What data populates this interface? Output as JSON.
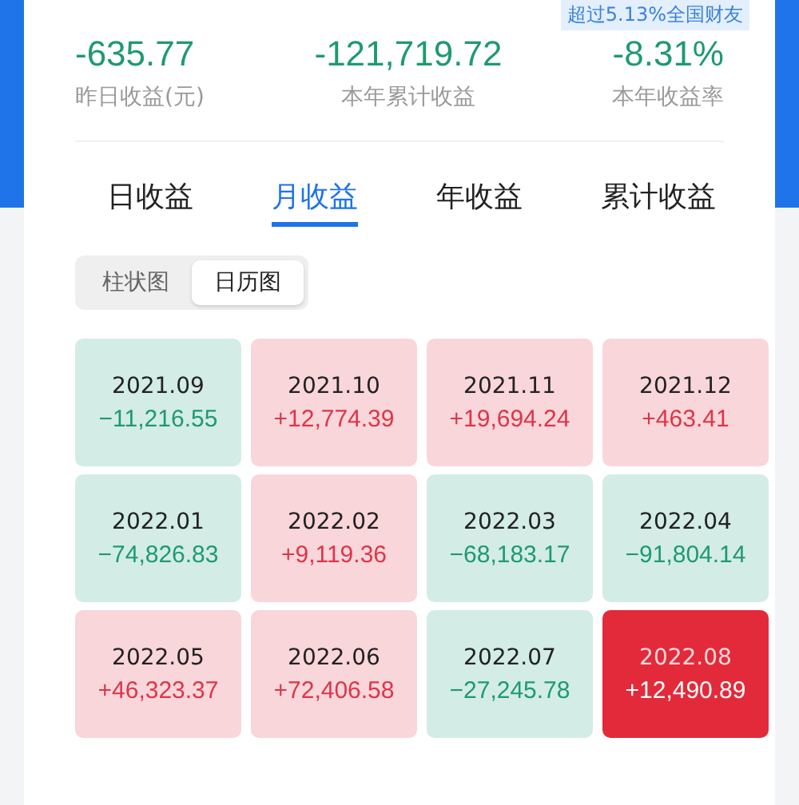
{
  "rank_badge": "超过5.13%全国财友",
  "stats": [
    {
      "value": "-635.77",
      "label": "昨日收益(元)"
    },
    {
      "value": "-121,719.72",
      "label": "本年累计收益"
    },
    {
      "value": "-8.31%",
      "label": "本年收益率"
    }
  ],
  "tabs": [
    {
      "label": "日收益",
      "selected": false
    },
    {
      "label": "月收益",
      "selected": true
    },
    {
      "label": "年收益",
      "selected": false
    },
    {
      "label": "累计收益",
      "selected": false
    }
  ],
  "view_toggle": [
    {
      "label": "柱状图",
      "selected": false
    },
    {
      "label": "日历图",
      "selected": true
    }
  ],
  "months": [
    {
      "month": "2021.09",
      "amount": "−11,216.55",
      "kind": "loss",
      "selected": false
    },
    {
      "month": "2021.10",
      "amount": "+12,774.39",
      "kind": "gain",
      "selected": false
    },
    {
      "month": "2021.11",
      "amount": "+19,694.24",
      "kind": "gain",
      "selected": false
    },
    {
      "month": "2021.12",
      "amount": "+463.41",
      "kind": "gain",
      "selected": false
    },
    {
      "month": "2022.01",
      "amount": "−74,826.83",
      "kind": "loss",
      "selected": false
    },
    {
      "month": "2022.02",
      "amount": "+9,119.36",
      "kind": "gain",
      "selected": false
    },
    {
      "month": "2022.03",
      "amount": "−68,183.17",
      "kind": "loss",
      "selected": false
    },
    {
      "month": "2022.04",
      "amount": "−91,804.14",
      "kind": "loss",
      "selected": false
    },
    {
      "month": "2022.05",
      "amount": "+46,323.37",
      "kind": "gain",
      "selected": false
    },
    {
      "month": "2022.06",
      "amount": "+72,406.58",
      "kind": "gain",
      "selected": false
    },
    {
      "month": "2022.07",
      "amount": "−27,245.78",
      "kind": "loss",
      "selected": false
    },
    {
      "month": "2022.08",
      "amount": "+12,490.89",
      "kind": "gain",
      "selected": true
    }
  ]
}
